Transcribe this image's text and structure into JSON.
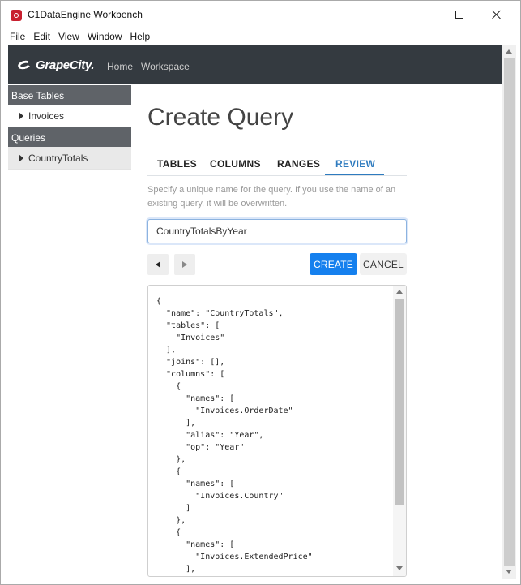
{
  "window": {
    "title": "C1DataEngine Workbench",
    "icon": "app-icon"
  },
  "menu": [
    "File",
    "Edit",
    "View",
    "Window",
    "Help"
  ],
  "navbar": {
    "brand": "GrapeCity.",
    "links": [
      "Home",
      "Workspace"
    ]
  },
  "sidebar": {
    "base_tables_header": "Base Tables",
    "base_tables": [
      "Invoices"
    ],
    "queries_header": "Queries",
    "queries": [
      "CountryTotals"
    ]
  },
  "page": {
    "title": "Create Query",
    "tabs": [
      "TABLES",
      "COLUMNS",
      "RANGES",
      "REVIEW"
    ],
    "active_tab": "REVIEW",
    "help_text": "Specify a unique name for the query. If you use the name of an existing query, it will be overwritten.",
    "name_value": "CountryTotalsByYear",
    "create_label": "CREATE",
    "cancel_label": "CANCEL",
    "json_preview": "{\n  \"name\": \"CountryTotals\",\n  \"tables\": [\n    \"Invoices\"\n  ],\n  \"joins\": [],\n  \"columns\": [\n    {\n      \"names\": [\n        \"Invoices.OrderDate\"\n      ],\n      \"alias\": \"Year\",\n      \"op\": \"Year\"\n    },\n    {\n      \"names\": [\n        \"Invoices.Country\"\n      ]\n    },\n    {\n      \"names\": [\n        \"Invoices.ExtendedPrice\"\n      ],"
  },
  "colors": {
    "navbar": "#343a40",
    "sidebar_header": "#5f6368",
    "accent": "#2e7bbf",
    "primary_button": "#1580ee"
  }
}
